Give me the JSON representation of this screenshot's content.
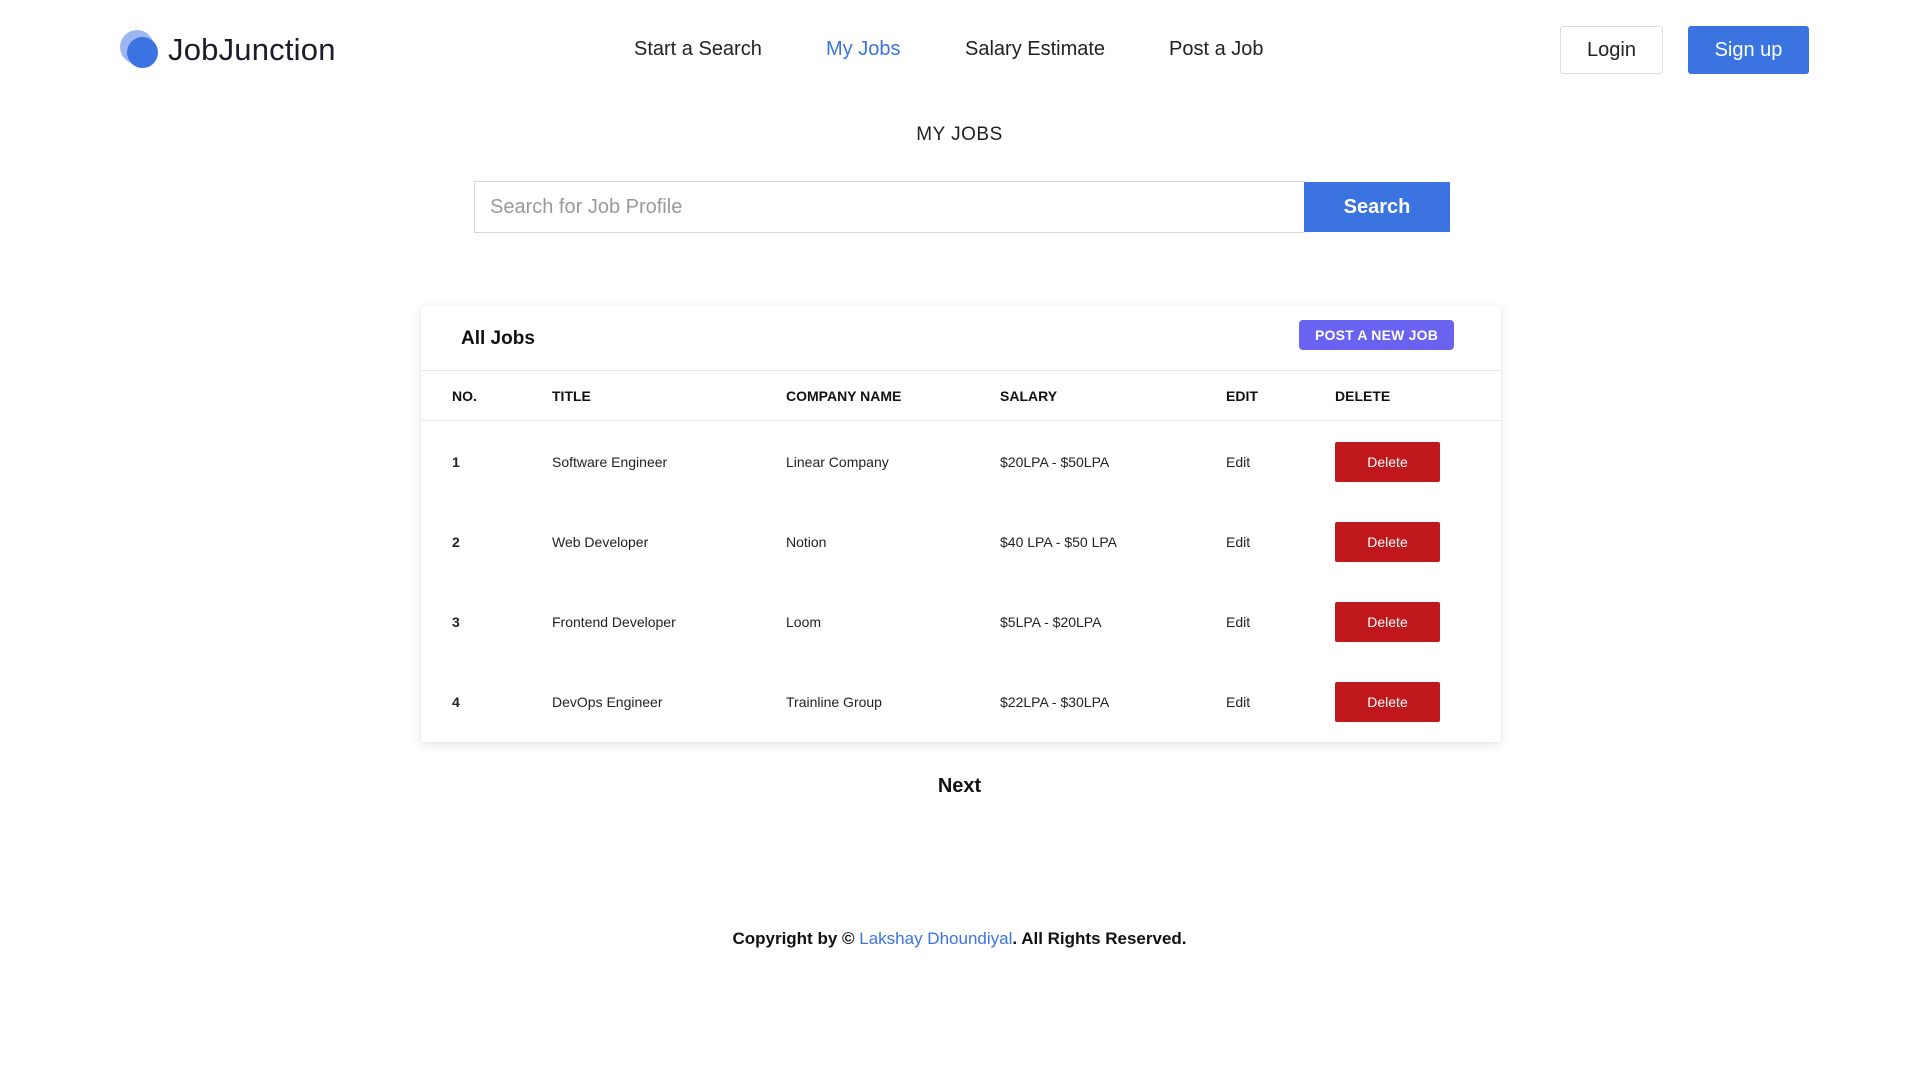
{
  "brand": {
    "name": "JobJunction"
  },
  "nav": {
    "items": [
      {
        "label": "Start a Search"
      },
      {
        "label": "My Jobs",
        "active": true
      },
      {
        "label": "Salary Estimate"
      },
      {
        "label": "Post a Job"
      }
    ]
  },
  "auth": {
    "login_label": "Login",
    "signup_label": "Sign up"
  },
  "page": {
    "title": "MY JOBS"
  },
  "search": {
    "placeholder": "Search for Job Profile",
    "value": "",
    "button_label": "Search"
  },
  "jobs_card": {
    "title": "All Jobs",
    "post_button_label": "POST A NEW JOB",
    "columns": [
      "NO.",
      "TITLE",
      "COMPANY NAME",
      "SALARY",
      "EDIT",
      "DELETE"
    ],
    "rows": [
      {
        "no": "1",
        "title": "Software Engineer",
        "company": "Linear Company",
        "salary": "$20LPA - $50LPA",
        "edit": "Edit",
        "delete": "Delete"
      },
      {
        "no": "2",
        "title": "Web Developer",
        "company": "Notion",
        "salary": "$40 LPA - $50 LPA",
        "edit": "Edit",
        "delete": "Delete"
      },
      {
        "no": "3",
        "title": "Frontend Developer",
        "company": "Loom",
        "salary": "$5LPA - $20LPA",
        "edit": "Edit",
        "delete": "Delete"
      },
      {
        "no": "4",
        "title": "DevOps Engineer",
        "company": "Trainline Group",
        "salary": "$22LPA - $30LPA",
        "edit": "Edit",
        "delete": "Delete"
      }
    ]
  },
  "pagination": {
    "next_label": "Next"
  },
  "footer": {
    "prefix": "Copyright by © ",
    "author": "Lakshay Dhoundiyal",
    "suffix": ". All Rights Reserved."
  },
  "colors": {
    "accent": "#3b74e0",
    "post_button": "#6a62f0",
    "delete_button": "#c0181d"
  }
}
